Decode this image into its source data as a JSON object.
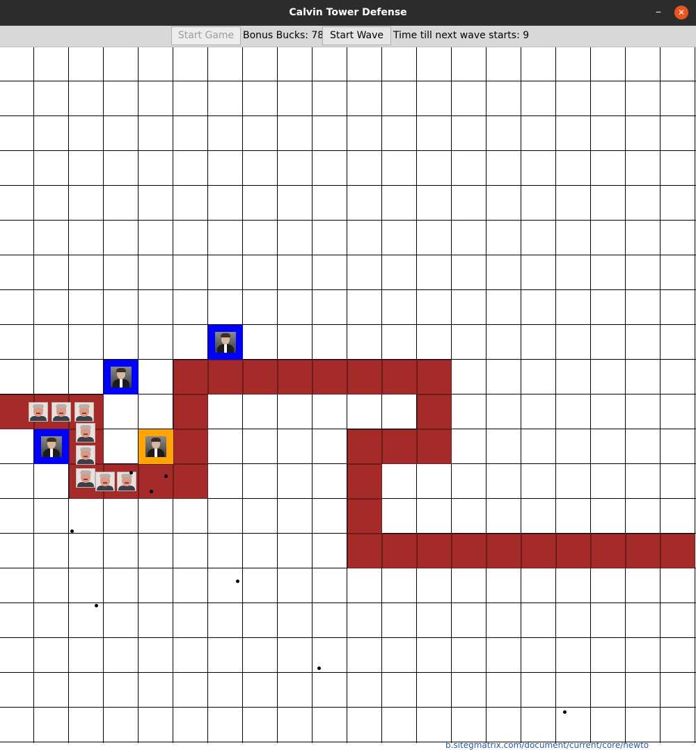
{
  "window": {
    "title": "Calvin Tower Defense",
    "minimize_glyph": "–",
    "close_glyph": "✕"
  },
  "toolbar": {
    "start_game_label": "Start Game",
    "bonus_bucks_label": "Bonus Bucks:  78",
    "start_wave_label": "Start Wave",
    "time_till_label": "Time till next wave starts:  9"
  },
  "board": {
    "cols": 20,
    "rows": 20,
    "path_color": "#a52a2a",
    "path_cells": [
      [
        0,
        10
      ],
      [
        1,
        10
      ],
      [
        2,
        10
      ],
      [
        2,
        11
      ],
      [
        2,
        12
      ],
      [
        3,
        12
      ],
      [
        4,
        12
      ],
      [
        5,
        12
      ],
      [
        5,
        11
      ],
      [
        5,
        10
      ],
      [
        5,
        9
      ],
      [
        6,
        9
      ],
      [
        7,
        9
      ],
      [
        8,
        9
      ],
      [
        9,
        9
      ],
      [
        10,
        9
      ],
      [
        11,
        9
      ],
      [
        12,
        9
      ],
      [
        12,
        10
      ],
      [
        12,
        11
      ],
      [
        11,
        11
      ],
      [
        10,
        11
      ],
      [
        10,
        12
      ],
      [
        10,
        13
      ],
      [
        10,
        14
      ],
      [
        11,
        14
      ],
      [
        12,
        14
      ],
      [
        13,
        14
      ],
      [
        14,
        14
      ],
      [
        15,
        14
      ],
      [
        16,
        14
      ],
      [
        17,
        14
      ],
      [
        18,
        14
      ],
      [
        19,
        14
      ]
    ],
    "towers": [
      {
        "col": 6,
        "row": 8,
        "color": "#0000ff",
        "icon": "professor-portrait-icon"
      },
      {
        "col": 3,
        "row": 9,
        "color": "#0000ff",
        "icon": "professor-portrait-icon"
      },
      {
        "col": 1,
        "row": 11,
        "color": "#0000ff",
        "icon": "professor-portrait-icon"
      },
      {
        "col": 4,
        "row": 11,
        "color": "#ffa500",
        "icon": "professor-portrait-icon"
      }
    ],
    "enemies": [
      {
        "col": 0,
        "row": 10,
        "slot": 0,
        "icon": "enemy-portrait-icon"
      },
      {
        "col": 1,
        "row": 10,
        "slot": 0,
        "icon": "enemy-portrait-icon"
      },
      {
        "col": 2,
        "row": 10,
        "slot": 0,
        "icon": "enemy-portrait-icon"
      },
      {
        "col": 2,
        "row": 11,
        "slot": 0,
        "icon": "enemy-portrait-icon"
      },
      {
        "col": 2,
        "row": 11,
        "slot": 1,
        "icon": "enemy-portrait-icon"
      },
      {
        "col": 2,
        "row": 12,
        "slot": 0,
        "icon": "enemy-portrait-icon"
      },
      {
        "col": 3,
        "row": 12,
        "slot": 0,
        "icon": "enemy-portrait-icon"
      },
      {
        "col": 3,
        "row": 12,
        "slot": 1,
        "icon": "enemy-portrait-icon"
      }
    ],
    "projectile_count": 8
  },
  "footer": {
    "partial_text": "b.sitegmatrix.com/document/current/core/newto"
  }
}
